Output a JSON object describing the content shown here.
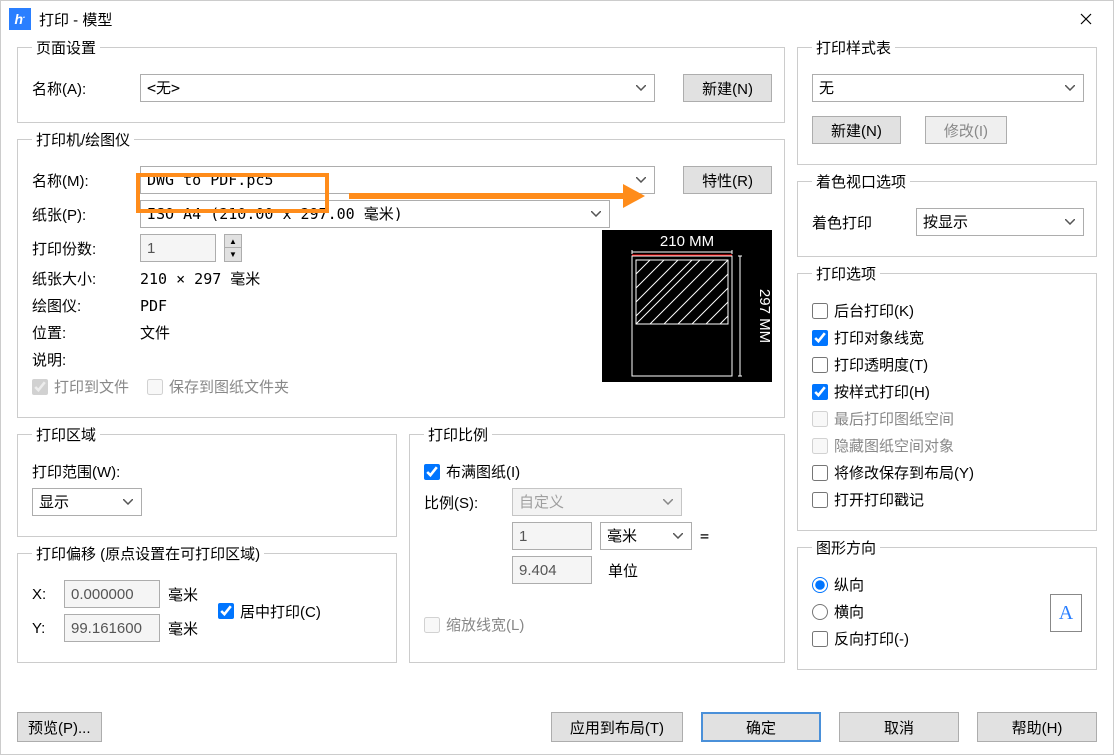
{
  "title": "打印 - 模型",
  "pageSetup": {
    "legend": "页面设置",
    "nameLabel": "名称(A):",
    "nameValue": "<无>",
    "newBtn": "新建(N)"
  },
  "printer": {
    "legend": "打印机/绘图仪",
    "nameLabel": "名称(M):",
    "nameValue": "DWG to PDF.pc5",
    "propsBtn": "特性(R)",
    "paperLabel": "纸张(P):",
    "paperValue": "ISO A4 (210.00 x 297.00 毫米)",
    "copiesLabel": "打印份数:",
    "copiesValue": "1",
    "sizeLabel": "纸张大小:",
    "sizeValue": "210 × 297  毫米",
    "plotterLabel": "绘图仪:",
    "plotterValue": "PDF",
    "locationLabel": "位置:",
    "locationValue": "文件",
    "descLabel": "说明:",
    "toFile": "打印到文件",
    "saveFolder": "保存到图纸文件夹",
    "previewW": "210 MM",
    "previewH": "297 MM"
  },
  "area": {
    "legend": "打印区域",
    "rangeLabel": "打印范围(W):",
    "rangeValue": "显示"
  },
  "scale": {
    "legend": "打印比例",
    "fit": "布满图纸(I)",
    "ratioLabel": "比例(S):",
    "ratioValue": "自定义",
    "unitTop": "1",
    "unitSel": "毫米",
    "eq": "=",
    "unitBottom": "9.404",
    "unitBottomLabel": "单位",
    "scaleLW": "缩放线宽(L)"
  },
  "offset": {
    "legend": "打印偏移 (原点设置在可打印区域)",
    "xLabel": "X:",
    "xValue": "0.000000",
    "yLabel": "Y:",
    "yValue": "99.161600",
    "unit": "毫米",
    "center": "居中打印(C)"
  },
  "style": {
    "legend": "打印样式表",
    "value": "无",
    "newBtn": "新建(N)",
    "modifyBtn": "修改(I)"
  },
  "shade": {
    "legend": "着色视口选项",
    "label": "着色打印",
    "value": "按显示"
  },
  "options": {
    "legend": "打印选项",
    "bg": "后台打印(K)",
    "lw": "打印对象线宽",
    "trans": "打印透明度(T)",
    "byStyle": "按样式打印(H)",
    "paperLast": "最后打印图纸空间",
    "hidePaper": "隐藏图纸空间对象",
    "saveLayout": "将修改保存到布局(Y)",
    "stamp": "打开打印戳记"
  },
  "orient": {
    "legend": "图形方向",
    "portrait": "纵向",
    "landscape": "横向",
    "reverse": "反向打印(-)",
    "iconLetter": "A"
  },
  "footer": {
    "preview": "预览(P)...",
    "apply": "应用到布局(T)",
    "ok": "确定",
    "cancel": "取消",
    "help": "帮助(H)"
  }
}
